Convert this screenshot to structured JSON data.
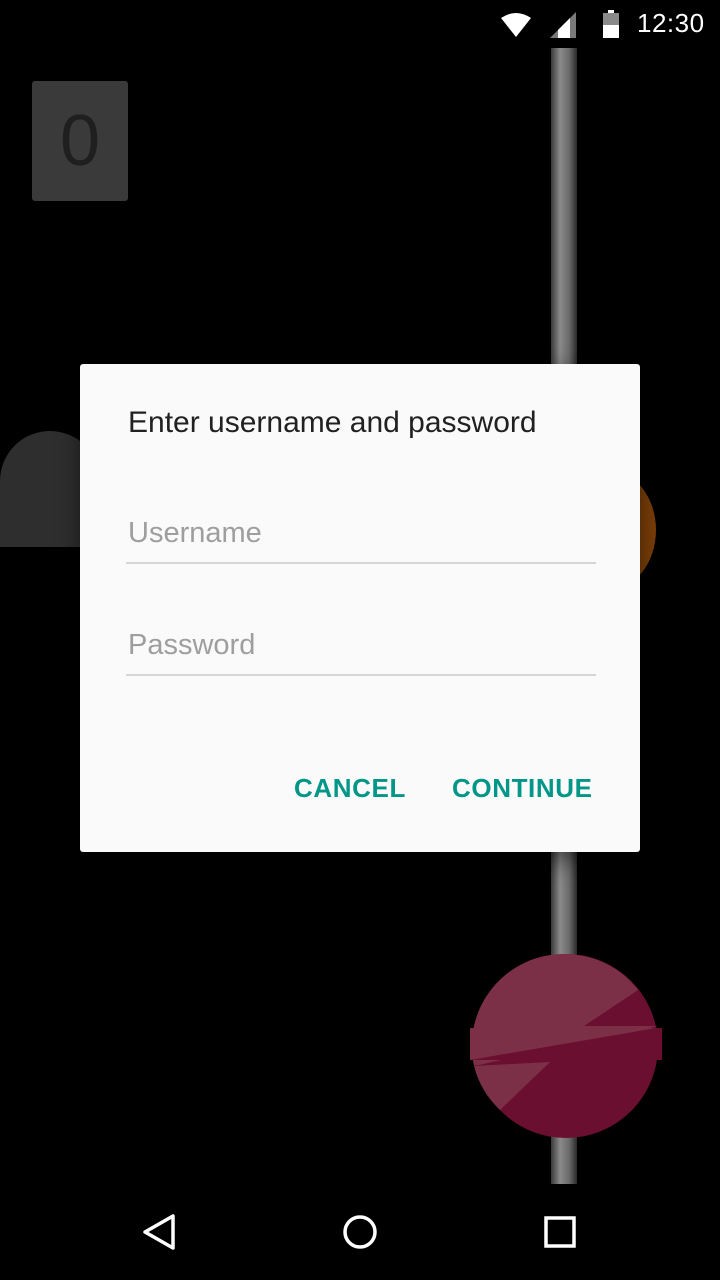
{
  "status_bar": {
    "time": "12:30",
    "icons": [
      "wifi-icon",
      "cell-signal-icon",
      "battery-icon"
    ]
  },
  "game": {
    "score": "0",
    "colors": {
      "score_box": "#3a3a3a",
      "orange_ball": "#7a3e08",
      "red_ball_light": "#7b3048",
      "red_ball_dark": "#6b0f30"
    }
  },
  "dialog": {
    "title": "Enter username and password",
    "username": {
      "value": "",
      "placeholder": "Username"
    },
    "password": {
      "value": "",
      "placeholder": "Password"
    },
    "cancel_label": "CANCEL",
    "continue_label": "CONTINUE",
    "accent_color": "#009688"
  },
  "nav_bar": {
    "icons": [
      "back-icon",
      "home-icon",
      "recent-apps-icon"
    ]
  }
}
